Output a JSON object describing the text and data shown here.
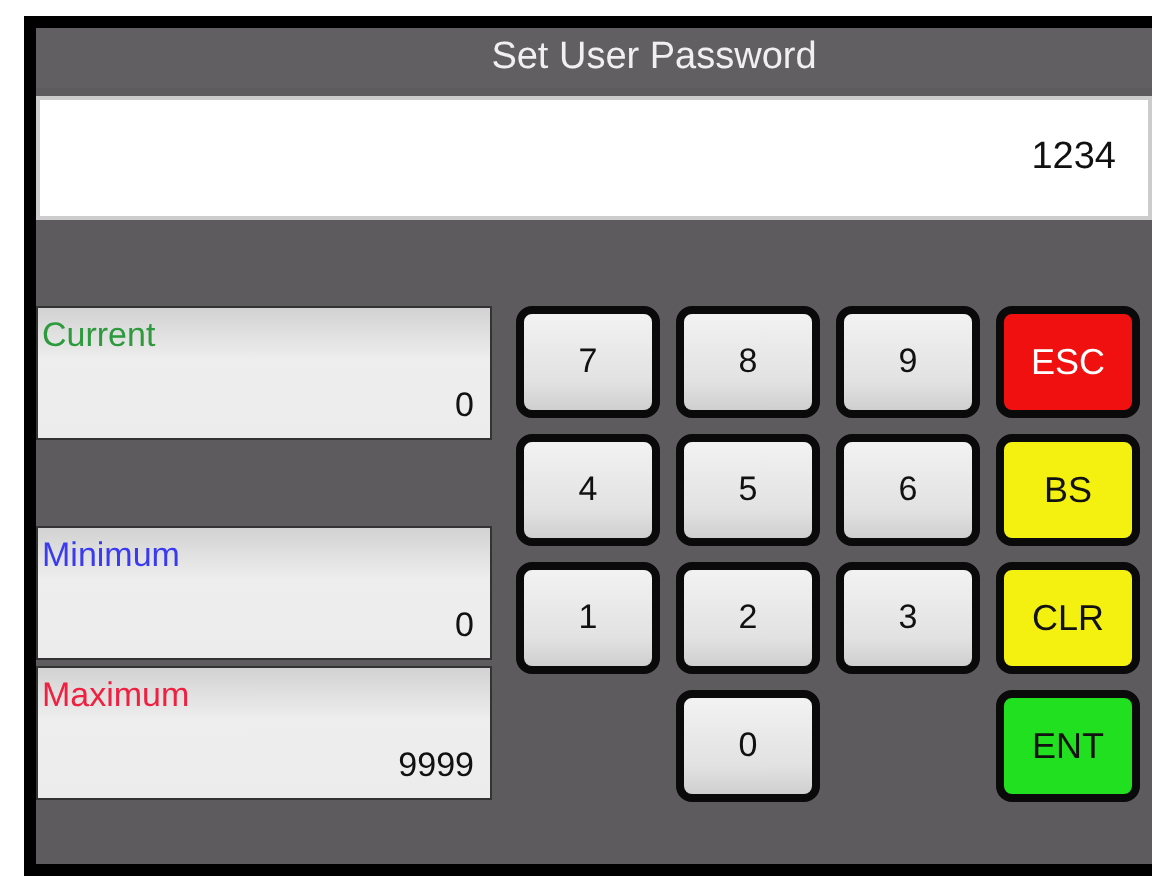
{
  "title": "Set User Password",
  "entry": {
    "value": "1234"
  },
  "readouts": [
    {
      "label": "Current",
      "color": "#2e9a3e",
      "value": "0"
    },
    {
      "label": "Minimum",
      "color": "#3a3af0",
      "value": "0"
    },
    {
      "label": "Maximum",
      "color": "#f02040",
      "value": "9999"
    }
  ],
  "digit_keys": [
    "7",
    "8",
    "9",
    "4",
    "5",
    "6",
    "1",
    "2",
    "3",
    "0"
  ],
  "function_keys": [
    {
      "label": "ESC",
      "color": "#f01010"
    },
    {
      "label": "BS",
      "color": "#f4f010"
    },
    {
      "label": "CLR",
      "color": "#f4f010"
    },
    {
      "label": "ENT",
      "color": "#20e020"
    }
  ]
}
